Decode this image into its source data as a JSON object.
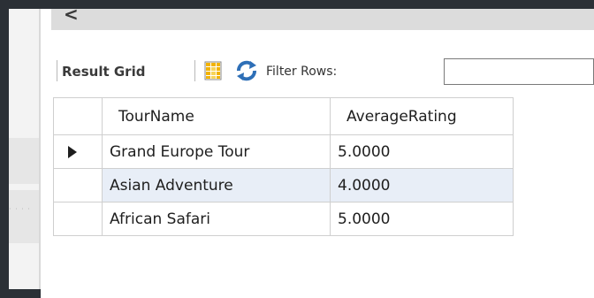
{
  "toolbar": {
    "result_grid_label": "Result Grid",
    "filter_label": "Filter Rows:",
    "filter_value": "",
    "icons": [
      "result-grid-icon",
      "refresh-icon"
    ]
  },
  "grid": {
    "columns": [
      "TourName",
      "AverageRating"
    ],
    "rows": [
      {
        "TourName": "Grand Europe Tour",
        "AverageRating": "5.0000",
        "current": true
      },
      {
        "TourName": "Asian Adventure",
        "AverageRating": "4.0000"
      },
      {
        "TourName": "African Safari",
        "AverageRating": "5.0000"
      }
    ]
  },
  "scrollbar": {
    "left_arrow": "<"
  },
  "colors": {
    "background": "#2b3036",
    "alt_row": "#e8eef7",
    "refresh_icon": "#2e6fb7",
    "grid_icon": "#f2b300"
  }
}
